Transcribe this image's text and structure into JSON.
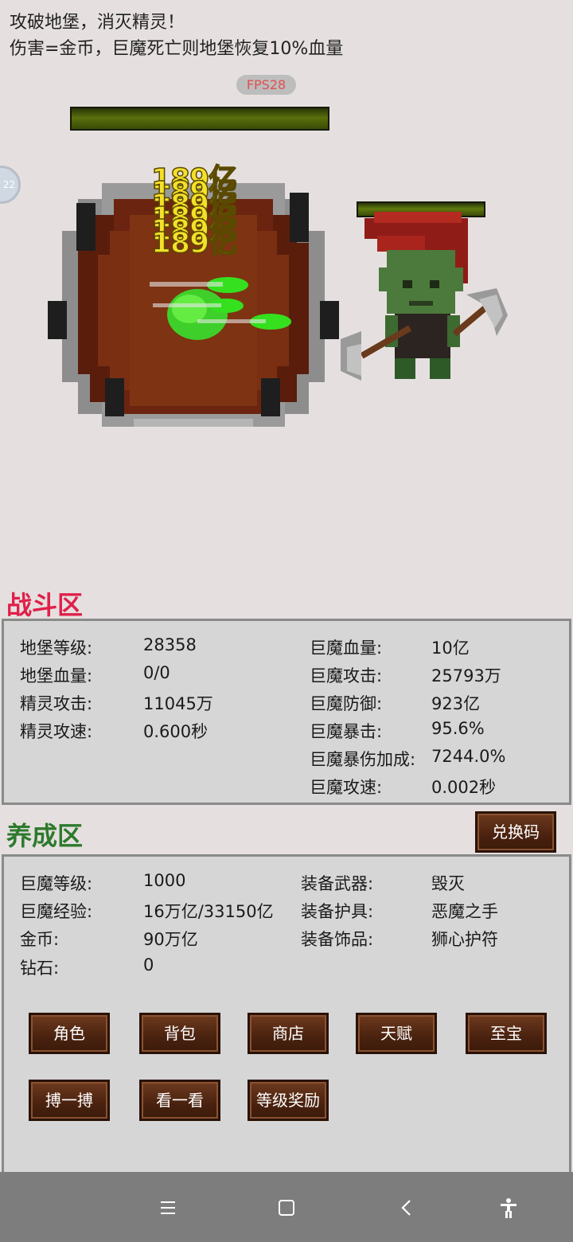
{
  "intro": {
    "line1": "攻破地堡，消灭精灵！",
    "line2": "伤害=金币，巨魔死亡则地堡恢复10%血量"
  },
  "fps": "FPS28",
  "side_badge": "22",
  "damage_popups": [
    "189亿",
    "189亿",
    "189亿",
    "189亿",
    "189亿",
    "189亿"
  ],
  "battle": {
    "title": "战斗区",
    "title_color": "#e0204a",
    "left_stats": [
      {
        "label": "地堡等级:",
        "value": "28358"
      },
      {
        "label": "地堡血量:",
        "value": "0/0"
      },
      {
        "label": "精灵攻击:",
        "value": "11045万"
      },
      {
        "label": "精灵攻速:",
        "value": "0.600秒"
      }
    ],
    "right_stats": [
      {
        "label": "巨魔血量:",
        "value": "10亿"
      },
      {
        "label": "巨魔攻击:",
        "value": "25793万"
      },
      {
        "label": "巨魔防御:",
        "value": "923亿"
      },
      {
        "label": "巨魔暴击:",
        "value": "95.6%"
      },
      {
        "label": "巨魔暴伤加成:",
        "value": "7244.0%"
      },
      {
        "label": "巨魔攻速:",
        "value": "0.002秒"
      }
    ]
  },
  "growth": {
    "title": "养成区",
    "title_color": "#2d7a2d",
    "redeem_button": "兑换码",
    "left_stats": [
      {
        "label": "巨魔等级:",
        "value": "1000"
      },
      {
        "label": "巨魔经验:",
        "value": "16万亿/33150亿"
      },
      {
        "label": "金币:",
        "value": "90万亿"
      },
      {
        "label": "钻石:",
        "value": "0"
      }
    ],
    "right_stats": [
      {
        "label": "装备武器:",
        "value": "毁灭"
      },
      {
        "label": "装备护具:",
        "value": "恶魔之手"
      },
      {
        "label": "装备饰品:",
        "value": "狮心护符"
      }
    ],
    "buttons_row1": [
      "角色",
      "背包",
      "商店",
      "天赋",
      "至宝"
    ],
    "buttons_row2": [
      "搏一搏",
      "看一看",
      "等级奖励"
    ]
  },
  "nav": {
    "icons": [
      "menu-icon",
      "home-square-icon",
      "back-chevron-icon",
      "accessibility-icon"
    ]
  }
}
